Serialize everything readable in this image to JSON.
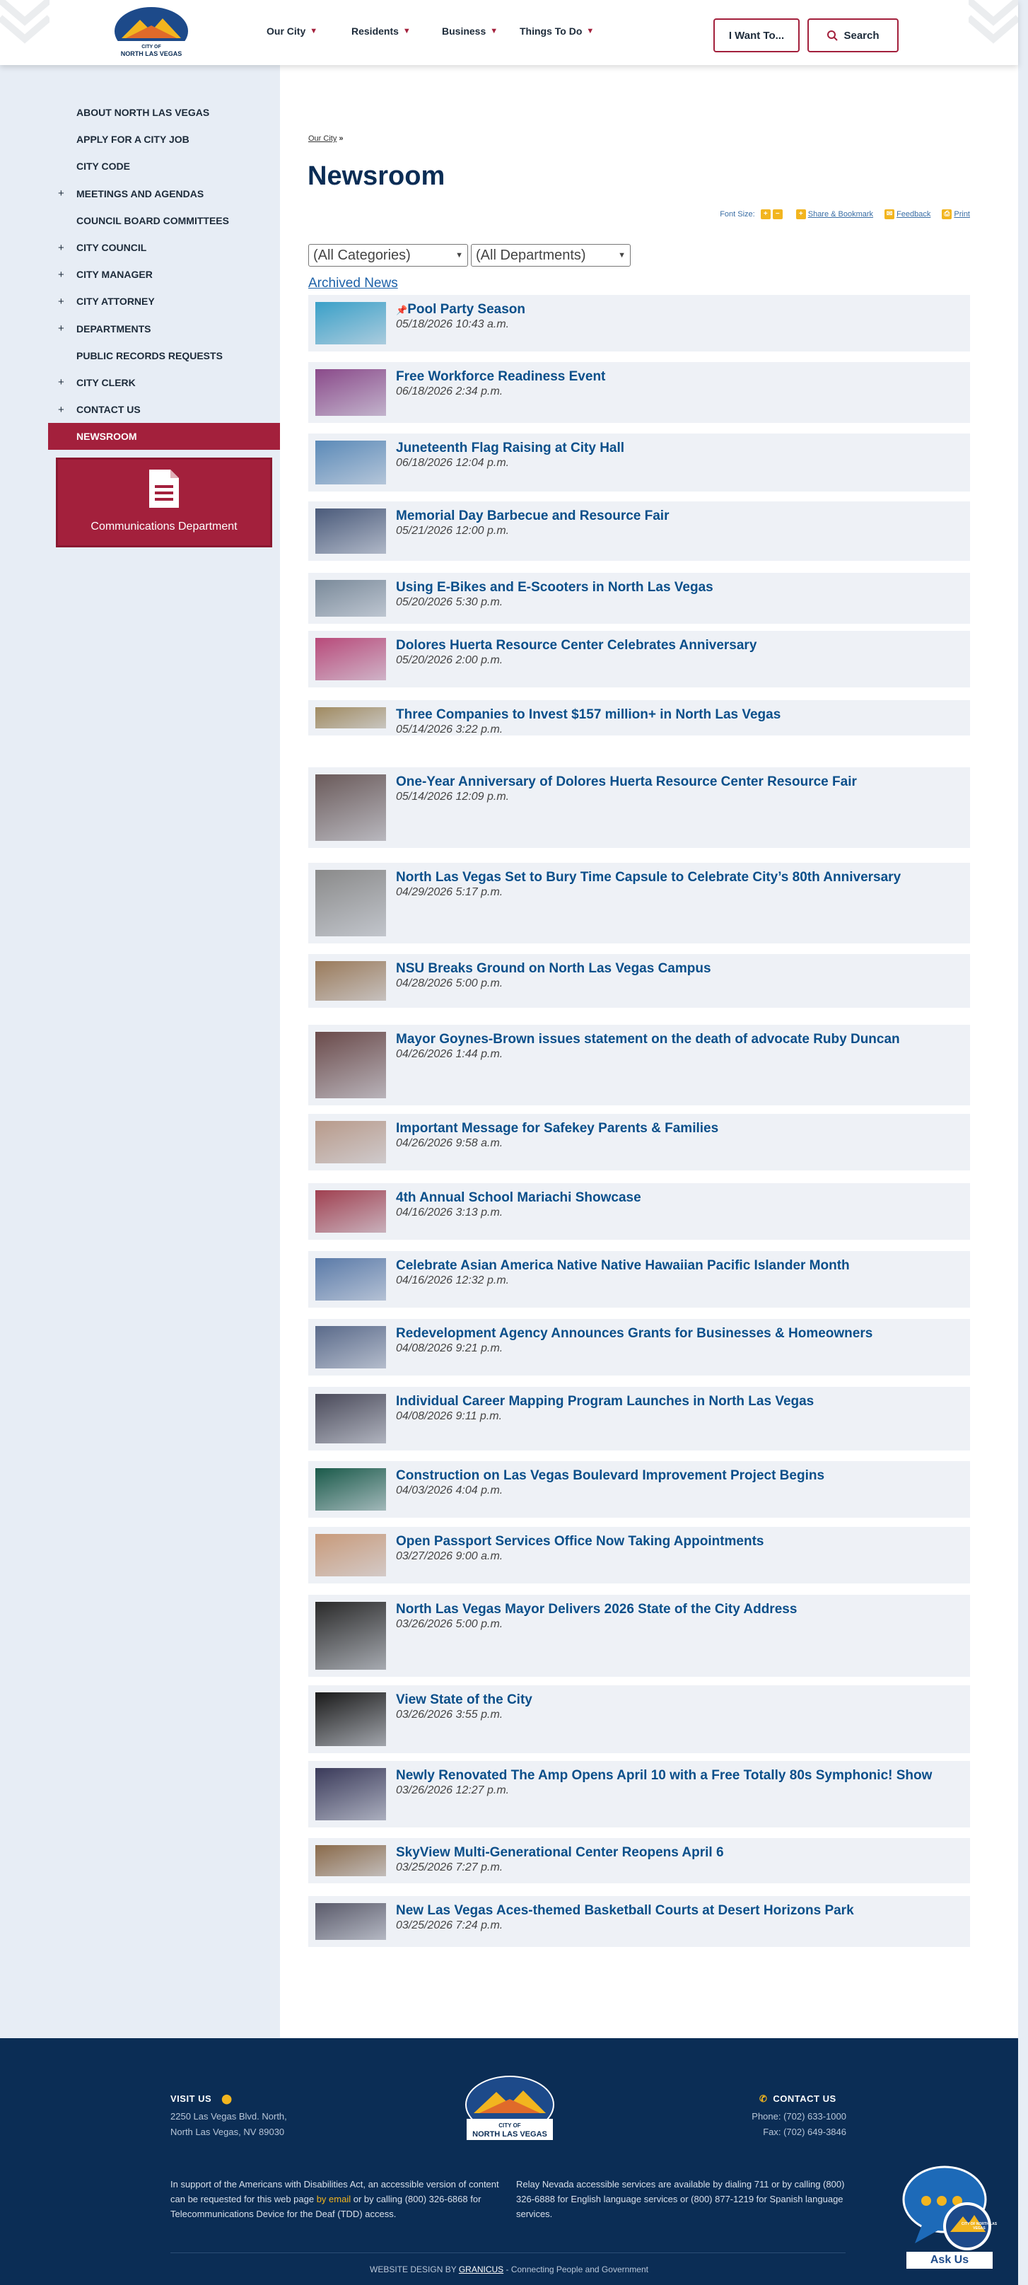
{
  "header": {
    "logo_text": "CITY OF NORTH LAS VEGAS",
    "nav": [
      "Our City",
      "Residents",
      "Business",
      "Things To Do"
    ],
    "i_want_to": "I Want To...",
    "search": "Search"
  },
  "sidebar": {
    "items": [
      {
        "label": "ABOUT NORTH LAS VEGAS",
        "plus": false
      },
      {
        "label": "APPLY FOR A CITY JOB",
        "plus": false
      },
      {
        "label": "CITY CODE",
        "plus": false
      },
      {
        "label": "MEETINGS AND AGENDAS",
        "plus": true
      },
      {
        "label": "COUNCIL BOARD COMMITTEES",
        "plus": false
      },
      {
        "label": "CITY COUNCIL",
        "plus": true
      },
      {
        "label": "CITY MANAGER",
        "plus": true
      },
      {
        "label": "CITY ATTORNEY",
        "plus": true
      },
      {
        "label": "DEPARTMENTS",
        "plus": true
      },
      {
        "label": "PUBLIC RECORDS REQUESTS",
        "plus": false
      },
      {
        "label": "CITY CLERK",
        "plus": true
      },
      {
        "label": "CONTACT US",
        "plus": true
      },
      {
        "label": "NEWSROOM",
        "plus": false,
        "active": true
      }
    ],
    "comm_label": "Communications Department"
  },
  "main": {
    "breadcrumb": "Our City",
    "breadcrumb_sep": "»",
    "title": "Newsroom",
    "font_size_label": "Font Size:",
    "share": "Share & Bookmark",
    "feedback": "Feedback",
    "print": "Print",
    "categories": "(All Categories)",
    "departments": "(All Departments)",
    "archived": "Archived News"
  },
  "news": [
    {
      "title": "Pool Party Season",
      "date": "05/18/2026 10:43 a.m.",
      "pinned": true,
      "color": "#3aa0c8"
    },
    {
      "title": "Free Workforce Readiness Event",
      "date": "06/18/2026 2:34 p.m.",
      "color": "#8a4a8a"
    },
    {
      "title": "Juneteenth Flag Raising at City Hall",
      "date": "06/18/2026 12:04 p.m.",
      "color": "#5b8ab8"
    },
    {
      "title": "Memorial Day Barbecue and Resource Fair",
      "date": "05/21/2026 12:00 p.m.",
      "color": "#4a5a7a"
    },
    {
      "title": "Using E-Bikes and E-Scooters in North Las Vegas",
      "date": "05/20/2026 5:30 p.m.",
      "color": "#7a8a9a"
    },
    {
      "title": "Dolores Huerta Resource Center Celebrates Anniversary",
      "date": "05/20/2026 2:00 p.m.",
      "color": "#b84a7a"
    },
    {
      "title": "Three Companies to Invest $157 million+ in North Las Vegas",
      "date": "05/14/2026 3:22 p.m.",
      "color": "#a08a60"
    },
    {
      "title": "One-Year Anniversary of Dolores Huerta Resource Center Resource Fair",
      "date": "05/14/2026 12:09 p.m.",
      "color": "#6a5a5a"
    },
    {
      "title": "North Las Vegas Set to Bury Time Capsule to Celebrate City’s 80th Anniversary",
      "date": "04/29/2026 5:17 p.m.",
      "color": "#8a8a8a"
    },
    {
      "title": "NSU Breaks Ground on North Las Vegas Campus",
      "date": "04/28/2026 5:00 p.m.",
      "color": "#9a7a5a"
    },
    {
      "title": "Mayor Goynes-Brown issues statement on the death of advocate Ruby Duncan",
      "date": "04/26/2026 1:44 p.m.",
      "color": "#6a4a4a"
    },
    {
      "title": "Important Message for Safekey Parents & Families",
      "date": "04/26/2026 9:58 a.m.",
      "color": "#b89a8a"
    },
    {
      "title": "4th Annual School Mariachi Showcase",
      "date": "04/16/2026 3:13 p.m.",
      "color": "#a04050"
    },
    {
      "title": "Celebrate Asian America Native Native Hawaiian Pacific Islander Month",
      "date": "04/16/2026 12:32 p.m.",
      "color": "#5a7aa8"
    },
    {
      "title": "Redevelopment Agency Announces Grants for Businesses & Homeowners",
      "date": "04/08/2026 9:21 p.m.",
      "color": "#5a6a8a"
    },
    {
      "title": "Individual Career Mapping Program Launches in North Las Vegas",
      "date": "04/08/2026 9:11 p.m.",
      "color": "#4a4a5a"
    },
    {
      "title": "Construction on Las Vegas Boulevard Improvement Project Begins",
      "date": "04/03/2026 4:04 p.m.",
      "color": "#1a5a4a"
    },
    {
      "title": "Open Passport Services Office Now Taking Appointments",
      "date": "03/27/2026 9:00 a.m.",
      "color": "#c89a7a"
    },
    {
      "title": "North Las Vegas Mayor Delivers 2026 State of the City Address",
      "date": "03/26/2026 5:00 p.m.",
      "color": "#2a2a2a"
    },
    {
      "title": "View State of the City",
      "date": "03/26/2026 3:55 p.m.",
      "color": "#1a1a1a"
    },
    {
      "title": "Newly Renovated The Amp Opens April 10 with a Free Totally 80s Symphonic! Show",
      "date": "03/26/2026 12:27 p.m.",
      "color": "#3a3a5a"
    },
    {
      "title": "SkyView Multi-Generational Center Reopens April 6",
      "date": "03/25/2026 7:27 p.m.",
      "color": "#8a6a4a"
    },
    {
      "title": "New Las Vegas Aces-themed Basketball Courts at Desert Horizons Park",
      "date": "03/25/2026 7:24 p.m.",
      "color": "#5a5a6a"
    }
  ],
  "footer": {
    "visit_us": "VISIT US",
    "address1": "2250 Las Vegas Blvd. North,",
    "address2": "North Las Vegas, NV 89030",
    "contact_us": "CONTACT US",
    "phone": "Phone: (702) 633-1000",
    "fax": "Fax: (702) 649-3846",
    "ada_pre": "In support of the Americans with Disabilities Act, an accessible version of content can be requested for this web page ",
    "ada_link": "by email",
    "ada_post": " or by calling (800) 326-6868 for Telecommunications Device for the Deaf (TDD) access.",
    "relay": "Relay Nevada accessible services are available by dialing 711 or by calling (800) 326-6888 for English language services or (800) 877-1219 for Spanish language services.",
    "design_pre": "WEBSITE DESIGN BY ",
    "design_link": "GRANICUS",
    "design_post": " - Connecting People and Government",
    "ask_us": "Ask Us",
    "ask_badge": "CITY OF NORTH LAS VEGAS"
  }
}
